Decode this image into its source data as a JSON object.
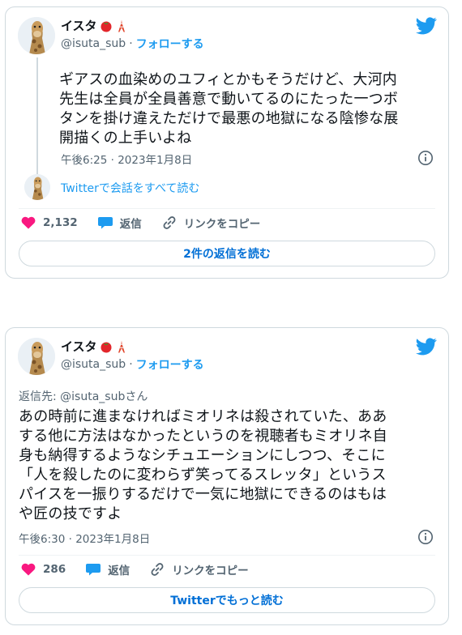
{
  "tweets": [
    {
      "display_name": "イスタ",
      "handle": "@isuta_sub",
      "follow_label": "フォローする",
      "text": "ギアスの血染めのユフィとかもそうだけど、大河内\n先生は全員が全員善意で動いてるのにたった一つボ\nタンを掛け違えただけで最悪の地獄になる陰惨な展\n開描くの上手いよね",
      "timestamp": "午後6:25 · 2023年1月8日",
      "read_thread": "Twitterで会話をすべて読む",
      "likes": "2,132",
      "reply_label": "返信",
      "copy_link_label": "リンクをコピー",
      "footer_button": "2件の返信を読む"
    },
    {
      "display_name": "イスタ",
      "handle": "@isuta_sub",
      "follow_label": "フォローする",
      "replying_to": "返信先: @isuta_subさん",
      "text": "あの時前に進まなければミオリネは殺されていた、ああ\nする他に方法はなかったというのを視聴者もミオリネ自\n身も納得するようなシチュエーションにしつつ、そこに\n「人を殺したのに変わらず笑ってるスレッタ」というス\nパイスを一振りするだけで一気に地獄にできるのはもは\nや匠の技ですよ",
      "timestamp": "午後6:30 · 2023年1月8日",
      "likes": "286",
      "reply_label": "返信",
      "copy_link_label": "リンクをコピー",
      "footer_button": "Twitterでもっと読む"
    }
  ],
  "colors": {
    "accent": "#1d9bf0",
    "like": "#f91880",
    "border": "#cfd9de",
    "secondary_text": "#536471"
  },
  "icons": [
    "giraffe-avatar",
    "tomato-emoji",
    "tokyo-tower-emoji",
    "twitter-bird-icon",
    "info-icon",
    "heart-icon",
    "reply-bubble-icon",
    "link-icon"
  ]
}
